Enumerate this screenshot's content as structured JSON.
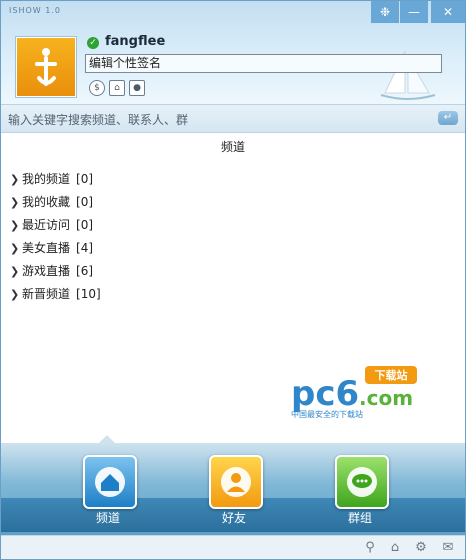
{
  "window": {
    "title": "ISHOW 1.0"
  },
  "profile": {
    "username": "fangflee",
    "signature": "编辑个性签名"
  },
  "search": {
    "placeholder": "输入关键字搜索频道、联系人、群"
  },
  "panel": {
    "title": "频道",
    "items": [
      {
        "label": "我的频道",
        "count": "[0]"
      },
      {
        "label": "我的收藏",
        "count": "[0]"
      },
      {
        "label": "最近访问",
        "count": "[0]"
      },
      {
        "label": "美女直播",
        "count": "[4]"
      },
      {
        "label": "游戏直播",
        "count": "[6]"
      },
      {
        "label": "新晋频道",
        "count": "[10]"
      }
    ]
  },
  "dock": {
    "channels": "频道",
    "friends": "好友",
    "groups": "群组"
  },
  "watermark": {
    "brand": "pc6",
    "domain": ".com",
    "tag": "下载站",
    "slogan": "中国最安全的下载站"
  },
  "colors": {
    "accent": "#69a8d6",
    "avatar": "#f29a10",
    "online": "#2fa236"
  }
}
